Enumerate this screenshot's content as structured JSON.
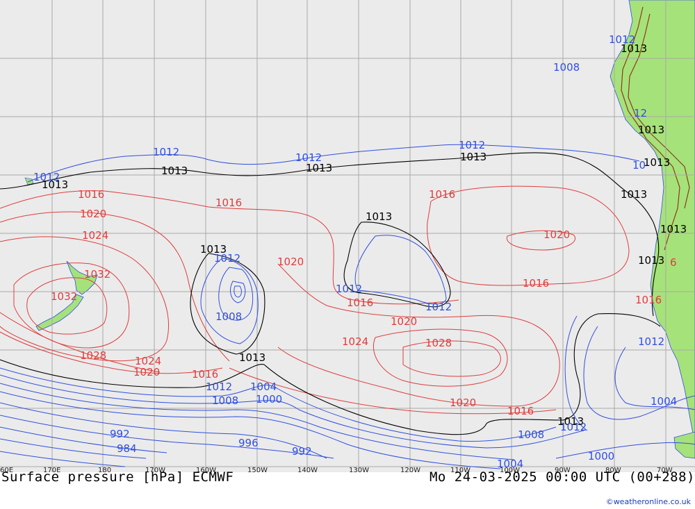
{
  "map": {
    "product_title": "Surface pressure [hPa] ECMWF",
    "valid_time": "Mo 24-03-2025 00:00 UTC (00+288)",
    "credit": "©weatheronline.co.uk",
    "colors": {
      "ocean": "#ebebeb",
      "land": "#a6e27a",
      "grid": "#a8a8a8",
      "high_isobar": "#e03c3c",
      "low_isobar": "#2f4fe0",
      "reference_isobar": "#000000",
      "terrain": "#8b3a1e"
    },
    "lon_labels": [
      "60E",
      "170E",
      "180",
      "170W",
      "160W",
      "150W",
      "140W",
      "130W",
      "120W",
      "110W",
      "100W",
      "90W",
      "80W",
      "70W"
    ],
    "isobar_labels": {
      "l1013a": "1013",
      "l1013b": "1013",
      "l1013c": "1013",
      "l1013d": "1013",
      "l1013e": "1013",
      "l1013f": "1013",
      "l1013g": "1013",
      "l1013h": "1013",
      "l1013i": "1013",
      "l1013j": "1013",
      "l1013k": "1013",
      "l1013l": "1013",
      "l1013m": "1013",
      "l1013n": "1013",
      "l1016a": "1016",
      "l1016b": "1016",
      "l1016c": "1016",
      "l1016d": "1016",
      "l1016e": "1016",
      "l1016f": "1016",
      "l1016g": "1016",
      "l1016h": "1016",
      "l1020a": "1020",
      "l1020b": "1020",
      "l1020c": "1020",
      "l1020d": "1020",
      "l1020e": "1020",
      "l1020f": "1020",
      "l1024a": "1024",
      "l1024b": "1024",
      "l1024c": "1024",
      "l1028a": "1028",
      "l1028b": "1028",
      "l1032a": "1032",
      "l1032b": "1032",
      "l1012a": "1012",
      "l1012b": "1012",
      "l1012c": "1012",
      "l1012d": "1012",
      "l1012e": "1012",
      "l1012f": "1012",
      "l1012g": "1012",
      "l1012h": "1012",
      "l1012i": "1012",
      "l1012j": "1012",
      "l1012k": "1012",
      "l1008a": "1008",
      "l1008b": "1008",
      "l1008c": "1008",
      "l1008d": "1008",
      "l1004a": "1004",
      "l1004b": "1004",
      "l1004c": "1004",
      "l1000a": "1000",
      "l1000b": "1000",
      "l996": "996",
      "l992a": "992",
      "l992b": "992",
      "l984": "984",
      "l10": "10",
      "l6": "6",
      "l12": "12"
    }
  }
}
